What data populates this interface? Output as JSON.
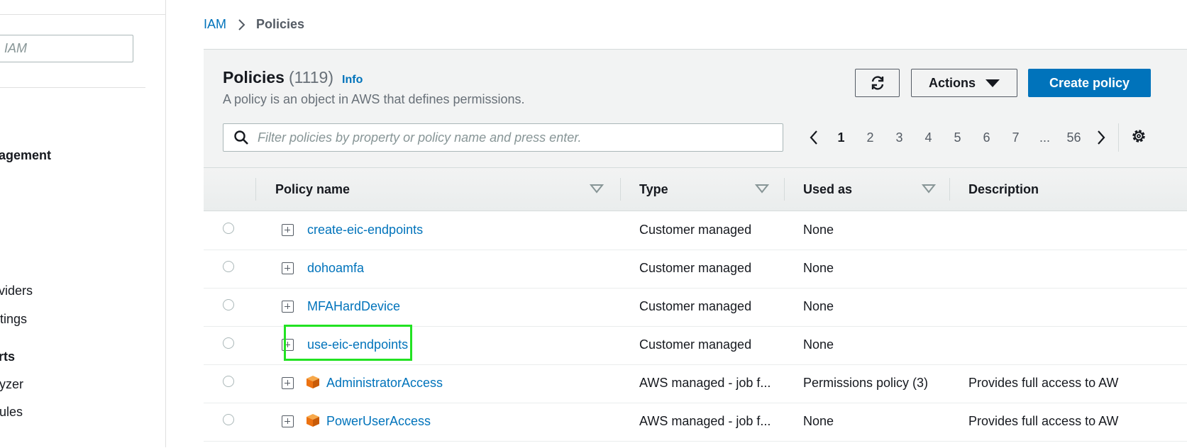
{
  "sidebar": {
    "search_placeholder": "IAM",
    "items": [
      "agement",
      "viders",
      "tings",
      "rts",
      "yzer",
      "ules"
    ]
  },
  "breadcrumb": {
    "root": "IAM",
    "current": "Policies"
  },
  "header": {
    "title": "Policies",
    "count": "(1119)",
    "info": "Info",
    "description": "A policy is an object in AWS that defines permissions.",
    "actions_label": "Actions",
    "create_label": "Create policy"
  },
  "filter": {
    "placeholder": "Filter policies by property or policy name and press enter."
  },
  "pagination": {
    "pages": [
      "1",
      "2",
      "3",
      "4",
      "5",
      "6",
      "7",
      "...",
      "56"
    ],
    "current": "1"
  },
  "table": {
    "columns": [
      "Policy name",
      "Type",
      "Used as",
      "Description"
    ],
    "rows": [
      {
        "name": "create-eic-endpoints",
        "type": "Customer managed",
        "used_as": "None",
        "description": "",
        "aws": false
      },
      {
        "name": "dohoamfa",
        "type": "Customer managed",
        "used_as": "None",
        "description": "",
        "aws": false
      },
      {
        "name": "MFAHardDevice",
        "type": "Customer managed",
        "used_as": "None",
        "description": "",
        "aws": false
      },
      {
        "name": "use-eic-endpoints",
        "type": "Customer managed",
        "used_as": "None",
        "description": "",
        "aws": false
      },
      {
        "name": "AdministratorAccess",
        "type": "AWS managed - job f...",
        "used_as": "Permissions policy (3)",
        "description": "Provides full access to AW",
        "aws": true
      },
      {
        "name": "PowerUserAccess",
        "type": "AWS managed - job f...",
        "used_as": "None",
        "description": "Provides full access to AW",
        "aws": true
      }
    ]
  },
  "colors": {
    "link": "#0073bb",
    "primary": "#0073bb",
    "highlight": "#22e222",
    "aws_icon": "#ec7211"
  },
  "icons": [
    "search-icon",
    "refresh-icon",
    "caret-down-icon",
    "chevron-left-icon",
    "chevron-right-icon",
    "gear-icon",
    "sort-icon",
    "expand-icon",
    "aws-cube-icon"
  ]
}
